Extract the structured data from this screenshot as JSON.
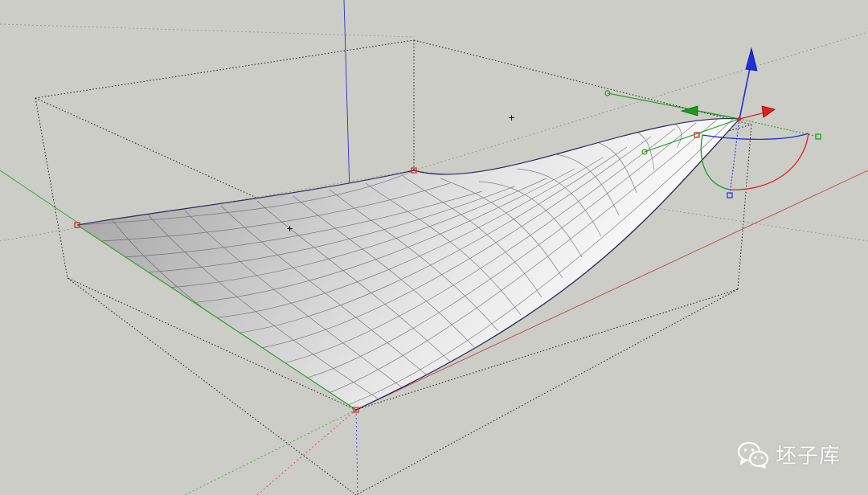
{
  "colors": {
    "background": "#cccdc6",
    "axis_red": "#b54a4a",
    "axis_green": "#3a9a3a",
    "axis_blue": "#2e2ecc",
    "gizmo_red": "#e02020",
    "gizmo_green": "#1d9a1d",
    "gizmo_blue": "#1f2fe0",
    "edge": "#2a2a55",
    "mesh_line": "#555555"
  },
  "watermark": {
    "icon": "wechat-icon",
    "text": "坯子库"
  }
}
